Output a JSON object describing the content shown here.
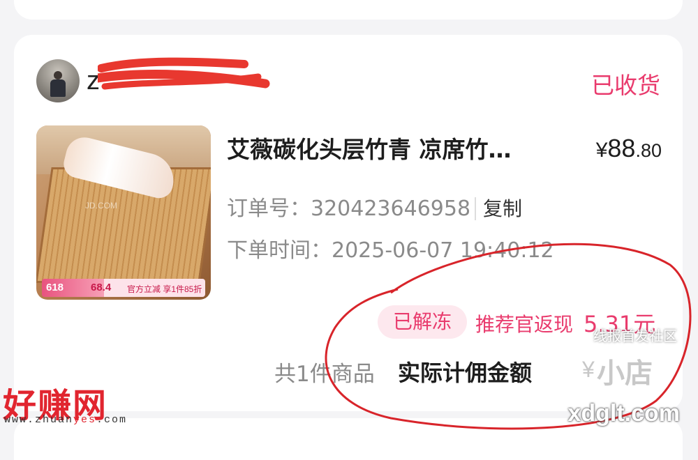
{
  "order": {
    "username": "z",
    "status": "已收货",
    "product": {
      "title": "艾薇碳化头层竹青 凉席竹…",
      "price_currency": "¥",
      "price_integer": "88",
      "price_decimal": ".80",
      "image": {
        "watermark": "JD.COM",
        "promo_618": "618",
        "promo_price": "68.4",
        "promo_text": "官方立减 享1件85折"
      }
    },
    "order_no_label": "订单号：",
    "order_no": "320423646958",
    "copy_label": "复制",
    "order_time_label": "下单时间：",
    "order_time": "2025-06-07 19:40:12",
    "unfrozen_badge": "已解冻",
    "rebate_label": "推荐官返现",
    "rebate_amount": "5.31元",
    "item_count": "共1件商品",
    "actual_commission_label": "实际计佣金额",
    "actual_commission_value": "¥"
  },
  "watermarks": {
    "logo": "好赚网",
    "url_prefix": "www.zhuan",
    "url_highlight": "yes",
    "url_suffix": ".com",
    "site": "xdglt.com",
    "community": "线报首发社区",
    "store": "小店"
  },
  "colors": {
    "accent_pink": "#e93b6d",
    "badge_bg": "#fde8ee",
    "annotation_red": "#d8242a"
  }
}
